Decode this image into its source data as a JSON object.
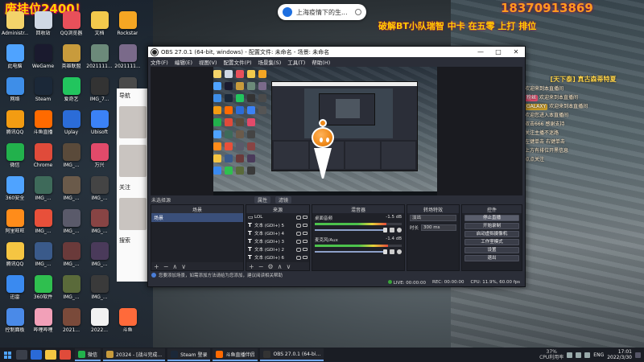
{
  "overlay": {
    "top_left_text": "废挂位2400！",
    "phone": "18370913869",
    "line2": "破解BT小队瑞智 中卡 在五零 上打 排位"
  },
  "search_pill": {
    "text": "上海疫情下的生..."
  },
  "desktop_icons": [
    {
      "label": "Administr...",
      "color": "#f3d36a"
    },
    {
      "label": "回收站",
      "color": "#cfd8e4"
    },
    {
      "label": "QQ浏览器",
      "color": "#e8505a"
    },
    {
      "label": "文档",
      "color": "#f2c94c"
    },
    {
      "label": "Rockstar",
      "color": "#f5a623"
    },
    {
      "label": "此电脑",
      "color": "#4fa3ff"
    },
    {
      "label": "WeGame",
      "color": "#1a1a2e"
    },
    {
      "label": "英雄联盟",
      "color": "#c89b3c"
    },
    {
      "label": "2021111...",
      "color": "#6c8a7a"
    },
    {
      "label": "2021111...",
      "color": "#7a6a8a"
    },
    {
      "label": "网络",
      "color": "#3e8ee8"
    },
    {
      "label": "Steam",
      "color": "#1b2838"
    },
    {
      "label": "爱奇艺",
      "color": "#22c55e"
    },
    {
      "label": "IMG_7...",
      "color": "#333333"
    },
    {
      "label": "IMG_...",
      "color": "#4a4a4a"
    },
    {
      "label": "腾讯QQ",
      "color": "#f39c12"
    },
    {
      "label": "斗鱼直播",
      "color": "#ff6a00"
    },
    {
      "label": "Uplay",
      "color": "#2b6cd8"
    },
    {
      "label": "Ubisoft",
      "color": "#3b82f6"
    },
    {
      "label": "UE",
      "color": "#555555"
    },
    {
      "label": "微信",
      "color": "#22b14c"
    },
    {
      "label": "Chrome",
      "color": "#e04b3a"
    },
    {
      "label": "IMG_...",
      "color": "#5a4a3a"
    },
    {
      "label": "万兴",
      "color": "#e24a6a"
    },
    {
      "label": "",
      "color": "rgba(0,0,0,0)"
    },
    {
      "label": "360安全",
      "color": "#4fa3ff"
    },
    {
      "label": "IMG_...",
      "color": "#3e6a5a"
    },
    {
      "label": "IMG_...",
      "color": "#6a5a4a"
    },
    {
      "label": "IMG_...",
      "color": "#444444"
    },
    {
      "label": "",
      "color": "rgba(0,0,0,0)"
    },
    {
      "label": "阿里旺旺",
      "color": "#ff8c1a"
    },
    {
      "label": "IMG_...",
      "color": "#e8503a"
    },
    {
      "label": "IMG_...",
      "color": "#5a5a6a"
    },
    {
      "label": "IMG_...",
      "color": "#884444"
    },
    {
      "label": "",
      "color": "rgba(0,0,0,0)"
    },
    {
      "label": "腾讯QQ",
      "color": "#f5c542"
    },
    {
      "label": "IMG_...",
      "color": "#3a5a8a"
    },
    {
      "label": "IMG_...",
      "color": "#6a3a3a"
    },
    {
      "label": "IMG_...",
      "color": "#4a3a5a"
    },
    {
      "label": "",
      "color": "rgba(0,0,0,0)"
    },
    {
      "label": "迅雷",
      "color": "#3a8af0"
    },
    {
      "label": "360软件",
      "color": "#2fbf4f"
    },
    {
      "label": "IMG_...",
      "color": "#5a6a3a"
    },
    {
      "label": "IMG_...",
      "color": "#3a3a3a"
    },
    {
      "label": "",
      "color": "rgba(0,0,0,0)"
    },
    {
      "label": "控制面板",
      "color": "#4a8ae8"
    },
    {
      "label": "哔哩哔哩",
      "color": "#f2a0b8"
    },
    {
      "label": "2021...",
      "color": "#7a4a3a"
    },
    {
      "label": "2022...",
      "color": "#f2f2f2"
    },
    {
      "label": "斗鱼",
      "color": "#ff6a3a"
    }
  ],
  "chat": {
    "title": "[天下泰] 真古森蒂特夏",
    "messages": [
      {
        "badge": "",
        "badge_style": "",
        "text": "欢迎来到本直播间"
      },
      {
        "badge": "粉丝",
        "badge_style": "",
        "text": "欢迎来到本直播间"
      },
      {
        "badge": "GALAXY",
        "badge_style": "gold",
        "text": "欢迎来到本直播间"
      },
      {
        "badge": "",
        "badge_style": "",
        "text": "欢迎您进入本直播间"
      },
      {
        "badge": "",
        "badge_style": "",
        "text": "双击666 感谢支持"
      },
      {
        "badge": "",
        "badge_style": "",
        "text": "关注主播不迷路"
      },
      {
        "badge": "",
        "badge_style": "",
        "text": "左键单击 右键单击"
      },
      {
        "badge": "",
        "badge_style": "",
        "text": "上方有排位开黑信息"
      },
      {
        "badge": "",
        "badge_style": "",
        "text": "点点关注"
      }
    ]
  },
  "side_panel": {
    "top": "导航",
    "text1": "关注",
    "text2": "搜索"
  },
  "obs": {
    "title": "OBS 27.0.1 (64-bit, windows) - 配置文件: 未命名 - 场景: 未命名",
    "menu": [
      "文件(F)",
      "编辑(E)",
      "视图(V)",
      "配置文件(P)",
      "场景集(S)",
      "工具(T)",
      "帮助(H)"
    ],
    "scene_line": {
      "left": "未选择源",
      "btn1": "属性",
      "btn2": "滤镜"
    },
    "docks": {
      "scenes": {
        "title": "场景",
        "items": [
          "场景"
        ]
      },
      "sources": {
        "title": "来源",
        "items": [
          "LOL",
          "文本 (GDI+) 5",
          "文本 (GDI+) 4",
          "文本 (GDI+) 3",
          "文本 (GDI+) 2",
          "文本 (GDI+) 6",
          "文本 (GDI+)"
        ]
      },
      "mixer": {
        "title": "混音器",
        "tracks": [
          {
            "name": "桌面音频",
            "db": "-1.5 dB",
            "level": 0.82
          },
          {
            "name": "麦克风/Aux",
            "db": "-1.4 dB",
            "level": 0.84
          }
        ]
      },
      "transitions": {
        "title": "转场特效",
        "mode": "淡出",
        "duration_label": "时长",
        "duration": "300 ms"
      },
      "controls": {
        "title": "控件",
        "buttons": [
          "停止直播",
          "开始录制",
          "启动虚拟摄像机",
          "工作室模式",
          "设置",
          "退出"
        ]
      }
    },
    "notice": "您要添加场景，如需添加方法请给为您添加，建议阅读相关帮助",
    "status": {
      "live": "LIVE: 00:00:00",
      "rec": "REC: 00:00:00",
      "cpu": "CPU: 11.9%, 60.00 fps"
    }
  },
  "taskbar": {
    "apps": [
      {
        "label": "微信",
        "color": "#22b14c"
      },
      {
        "label": "20324 - [战斗完成...",
        "color": "#c89b3c"
      },
      {
        "label": "Steam 登录",
        "color": "#1b2838"
      },
      {
        "label": "斗鱼直播伴侣",
        "color": "#ff6a00"
      },
      {
        "label": "OBS 27.0.1 (64-bi...",
        "color": "#333333"
      }
    ],
    "usage_top": "37%",
    "usage_bottom": "CPU利用率",
    "lang": "ENG",
    "time": "17:01",
    "date": "2022/3/30"
  }
}
